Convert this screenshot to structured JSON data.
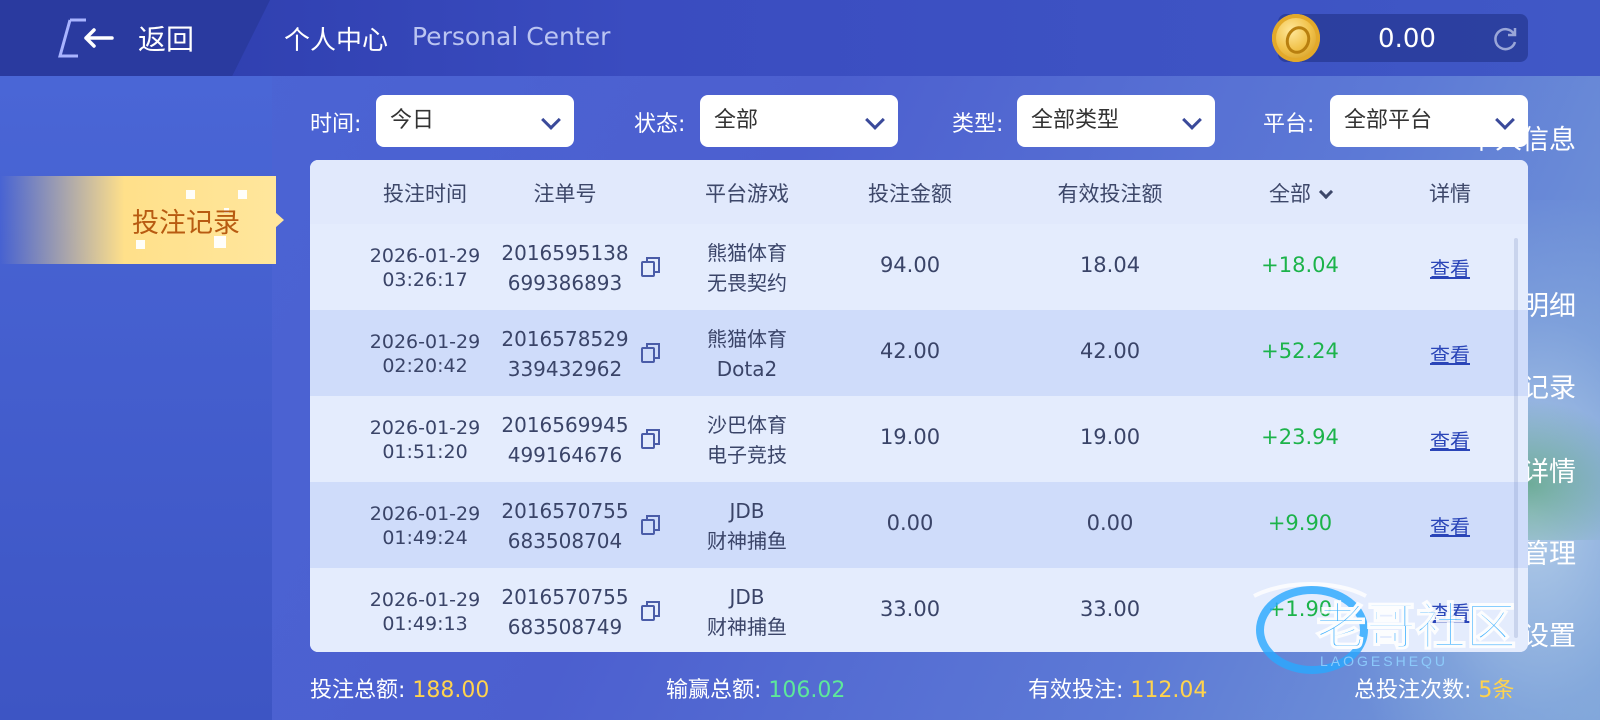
{
  "header": {
    "back_label": "返回",
    "title_cn": "个人中心",
    "title_en": "Personal Center",
    "balance": "0.00"
  },
  "sidebar": {
    "items": [
      {
        "label": "个人信息"
      },
      {
        "label": "投注记录",
        "active": true
      },
      {
        "label": "资金明细"
      },
      {
        "label": "优惠记录"
      },
      {
        "label": "VIP详情"
      },
      {
        "label": "密码管理"
      },
      {
        "label": "设置"
      }
    ]
  },
  "filters": {
    "time": {
      "label": "时间:",
      "value": "今日"
    },
    "status": {
      "label": "状态:",
      "value": "全部"
    },
    "type": {
      "label": "类型:",
      "value": "全部类型"
    },
    "platform": {
      "label": "平台:",
      "value": "全部平台"
    }
  },
  "table": {
    "headers": [
      "投注时间",
      "注单号",
      "平台游戏",
      "投注金额",
      "有效投注额",
      "全部",
      "详情"
    ],
    "rows": [
      {
        "date": "2026-01-29",
        "time": "03:26:17",
        "order1": "2016595138",
        "order2": "699386893",
        "game1": "熊猫体育",
        "game2": "无畏契约",
        "amount": "94.00",
        "valid": "18.04",
        "win": "+18.04",
        "detail": "查看"
      },
      {
        "date": "2026-01-29",
        "time": "02:20:42",
        "order1": "2016578529",
        "order2": "339432962",
        "game1": "熊猫体育",
        "game2": "Dota2",
        "amount": "42.00",
        "valid": "42.00",
        "win": "+52.24",
        "detail": "查看"
      },
      {
        "date": "2026-01-29",
        "time": "01:51:20",
        "order1": "2016569945",
        "order2": "499164676",
        "game1": "沙巴体育",
        "game2": "电子竞技",
        "amount": "19.00",
        "valid": "19.00",
        "win": "+23.94",
        "detail": "查看"
      },
      {
        "date": "2026-01-29",
        "time": "01:49:24",
        "order1": "2016570755",
        "order2": "683508704",
        "game1": "JDB",
        "game2": "财神捕鱼",
        "amount": "0.00",
        "valid": "0.00",
        "win": "+9.90",
        "detail": "查看"
      },
      {
        "date": "2026-01-29",
        "time": "01:49:13",
        "order1": "2016570755",
        "order2": "683508749",
        "game1": "JDB",
        "game2": "财神捕鱼",
        "amount": "33.00",
        "valid": "33.00",
        "win": "+1.90",
        "detail": "查看"
      }
    ]
  },
  "summary": {
    "total_bet_label": "投注总额:",
    "total_bet": "188.00",
    "win_loss_label": "输赢总额:",
    "win_loss": "106.02",
    "valid_label": "有效投注:",
    "valid": "112.04",
    "count_label": "总投注次数:",
    "count": "5条"
  },
  "watermark": {
    "text": "老哥社区",
    "sub": "LAOGESHEQU"
  },
  "colors": {
    "accent_yellow": "#ffd34d",
    "win_green": "#1cb34a",
    "active_tab": "#ffe08a"
  }
}
